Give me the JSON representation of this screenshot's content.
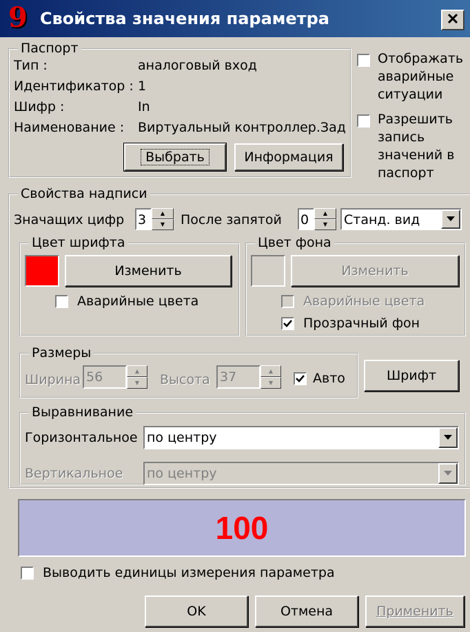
{
  "window": {
    "title": "Свойства значения параметра",
    "logo": "9",
    "close_glyph": "✕"
  },
  "passport": {
    "legend": "Паспорт",
    "type_label": "Тип :",
    "type_value": "аналоговый вход",
    "id_label": "Идентификатор :",
    "id_value": "1",
    "cipher_label": "Шифр :",
    "cipher_value": "In",
    "name_label": "Наименование :",
    "name_value": "Виртуальный контроллер.Зад",
    "select_button": "Выбрать",
    "info_button": "Информация"
  },
  "options": {
    "show_alarms": {
      "label_lines": [
        "Отображать",
        "аварийные",
        "ситуации"
      ],
      "checked": false
    },
    "allow_write": {
      "label_lines": [
        "Разрешить",
        "запись",
        "значений в",
        "паспорт"
      ],
      "checked": false
    }
  },
  "label_props": {
    "legend": "Свойства надписи",
    "sig_digits_label": "Значащих цифр",
    "sig_digits_value": "3",
    "after_comma_label": "После запятой",
    "after_comma_value": "0",
    "view_value": "Станд. вид"
  },
  "font_color": {
    "legend": "Цвет шрифта",
    "swatch": "#ff0000",
    "change_button": "Изменить",
    "alarm_colors_label": "Аварийные цвета",
    "alarm_colors_checked": false
  },
  "bg_color": {
    "legend": "Цвет фона",
    "change_button": "Изменить",
    "alarm_colors_label": "Аварийные цвета",
    "alarm_colors_checked": false,
    "transparent_label": "Прозрачный фон",
    "transparent_checked": true
  },
  "sizes": {
    "legend": "Размеры",
    "width_label": "Ширина",
    "width_value": "56",
    "height_label": "Высота",
    "height_value": "37",
    "auto_label": "Авто",
    "auto_checked": true
  },
  "font_button": "Шрифт",
  "alignment": {
    "legend": "Выравнивание",
    "horizontal_label": "Горизонтальное",
    "horizontal_value": "по центру",
    "vertical_label": "Вертикальное",
    "vertical_value": "по центру"
  },
  "preview": {
    "value": "100",
    "background": "#b4b4d8",
    "text_color": "#ff0000"
  },
  "units_checkbox": {
    "label": "Выводить единицы измерения параметра",
    "checked": false
  },
  "footer": {
    "ok": "OK",
    "cancel": "Отмена",
    "apply": "Применить"
  }
}
